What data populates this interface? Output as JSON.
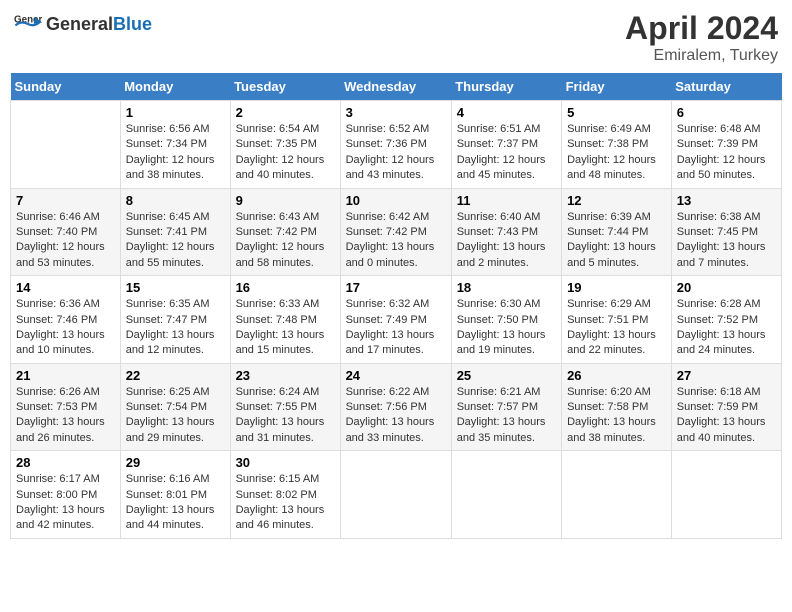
{
  "header": {
    "logo_general": "General",
    "logo_blue": "Blue",
    "title": "April 2024",
    "subtitle": "Emiralem, Turkey"
  },
  "days_of_week": [
    "Sunday",
    "Monday",
    "Tuesday",
    "Wednesday",
    "Thursday",
    "Friday",
    "Saturday"
  ],
  "weeks": [
    [
      {
        "day": "",
        "info": ""
      },
      {
        "day": "1",
        "info": "Sunrise: 6:56 AM\nSunset: 7:34 PM\nDaylight: 12 hours and 38 minutes."
      },
      {
        "day": "2",
        "info": "Sunrise: 6:54 AM\nSunset: 7:35 PM\nDaylight: 12 hours and 40 minutes."
      },
      {
        "day": "3",
        "info": "Sunrise: 6:52 AM\nSunset: 7:36 PM\nDaylight: 12 hours and 43 minutes."
      },
      {
        "day": "4",
        "info": "Sunrise: 6:51 AM\nSunset: 7:37 PM\nDaylight: 12 hours and 45 minutes."
      },
      {
        "day": "5",
        "info": "Sunrise: 6:49 AM\nSunset: 7:38 PM\nDaylight: 12 hours and 48 minutes."
      },
      {
        "day": "6",
        "info": "Sunrise: 6:48 AM\nSunset: 7:39 PM\nDaylight: 12 hours and 50 minutes."
      }
    ],
    [
      {
        "day": "7",
        "info": "Sunrise: 6:46 AM\nSunset: 7:40 PM\nDaylight: 12 hours and 53 minutes."
      },
      {
        "day": "8",
        "info": "Sunrise: 6:45 AM\nSunset: 7:41 PM\nDaylight: 12 hours and 55 minutes."
      },
      {
        "day": "9",
        "info": "Sunrise: 6:43 AM\nSunset: 7:42 PM\nDaylight: 12 hours and 58 minutes."
      },
      {
        "day": "10",
        "info": "Sunrise: 6:42 AM\nSunset: 7:42 PM\nDaylight: 13 hours and 0 minutes."
      },
      {
        "day": "11",
        "info": "Sunrise: 6:40 AM\nSunset: 7:43 PM\nDaylight: 13 hours and 2 minutes."
      },
      {
        "day": "12",
        "info": "Sunrise: 6:39 AM\nSunset: 7:44 PM\nDaylight: 13 hours and 5 minutes."
      },
      {
        "day": "13",
        "info": "Sunrise: 6:38 AM\nSunset: 7:45 PM\nDaylight: 13 hours and 7 minutes."
      }
    ],
    [
      {
        "day": "14",
        "info": "Sunrise: 6:36 AM\nSunset: 7:46 PM\nDaylight: 13 hours and 10 minutes."
      },
      {
        "day": "15",
        "info": "Sunrise: 6:35 AM\nSunset: 7:47 PM\nDaylight: 13 hours and 12 minutes."
      },
      {
        "day": "16",
        "info": "Sunrise: 6:33 AM\nSunset: 7:48 PM\nDaylight: 13 hours and 15 minutes."
      },
      {
        "day": "17",
        "info": "Sunrise: 6:32 AM\nSunset: 7:49 PM\nDaylight: 13 hours and 17 minutes."
      },
      {
        "day": "18",
        "info": "Sunrise: 6:30 AM\nSunset: 7:50 PM\nDaylight: 13 hours and 19 minutes."
      },
      {
        "day": "19",
        "info": "Sunrise: 6:29 AM\nSunset: 7:51 PM\nDaylight: 13 hours and 22 minutes."
      },
      {
        "day": "20",
        "info": "Sunrise: 6:28 AM\nSunset: 7:52 PM\nDaylight: 13 hours and 24 minutes."
      }
    ],
    [
      {
        "day": "21",
        "info": "Sunrise: 6:26 AM\nSunset: 7:53 PM\nDaylight: 13 hours and 26 minutes."
      },
      {
        "day": "22",
        "info": "Sunrise: 6:25 AM\nSunset: 7:54 PM\nDaylight: 13 hours and 29 minutes."
      },
      {
        "day": "23",
        "info": "Sunrise: 6:24 AM\nSunset: 7:55 PM\nDaylight: 13 hours and 31 minutes."
      },
      {
        "day": "24",
        "info": "Sunrise: 6:22 AM\nSunset: 7:56 PM\nDaylight: 13 hours and 33 minutes."
      },
      {
        "day": "25",
        "info": "Sunrise: 6:21 AM\nSunset: 7:57 PM\nDaylight: 13 hours and 35 minutes."
      },
      {
        "day": "26",
        "info": "Sunrise: 6:20 AM\nSunset: 7:58 PM\nDaylight: 13 hours and 38 minutes."
      },
      {
        "day": "27",
        "info": "Sunrise: 6:18 AM\nSunset: 7:59 PM\nDaylight: 13 hours and 40 minutes."
      }
    ],
    [
      {
        "day": "28",
        "info": "Sunrise: 6:17 AM\nSunset: 8:00 PM\nDaylight: 13 hours and 42 minutes."
      },
      {
        "day": "29",
        "info": "Sunrise: 6:16 AM\nSunset: 8:01 PM\nDaylight: 13 hours and 44 minutes."
      },
      {
        "day": "30",
        "info": "Sunrise: 6:15 AM\nSunset: 8:02 PM\nDaylight: 13 hours and 46 minutes."
      },
      {
        "day": "",
        "info": ""
      },
      {
        "day": "",
        "info": ""
      },
      {
        "day": "",
        "info": ""
      },
      {
        "day": "",
        "info": ""
      }
    ]
  ]
}
